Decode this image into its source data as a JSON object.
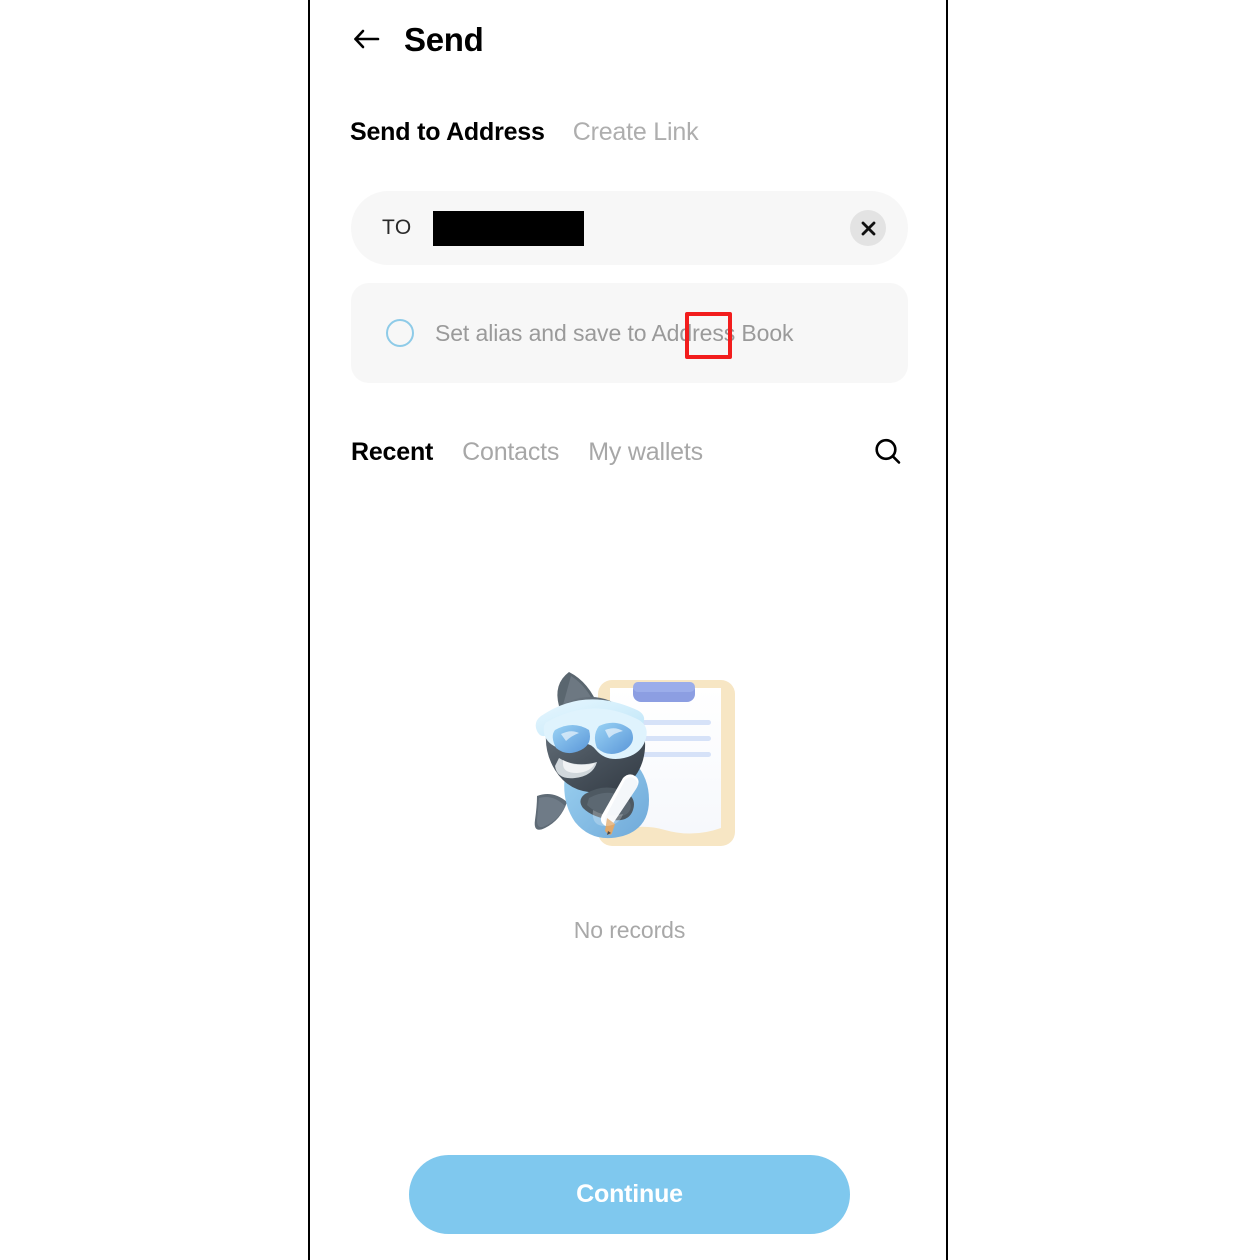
{
  "header": {
    "back_icon": "arrow-left-icon",
    "title": "Send"
  },
  "mode_tabs": [
    {
      "label": "Send to Address",
      "active": true
    },
    {
      "label": "Create Link",
      "active": false
    }
  ],
  "recipient_field": {
    "label": "TO",
    "value": "",
    "value_redacted": true,
    "placeholder": "",
    "clear_icon": "close-icon"
  },
  "alias_option": {
    "label": "Set alias and save to Address Book",
    "checked": false,
    "radio_icon": "radio-unchecked-icon",
    "highlighted": true,
    "highlight_color": "#F21D1D"
  },
  "list_tabs": [
    {
      "label": "Recent",
      "active": true
    },
    {
      "label": "Contacts",
      "active": false
    },
    {
      "label": "My wallets",
      "active": false
    }
  ],
  "search": {
    "icon": "search-icon"
  },
  "empty_state": {
    "illustration": "shark-mascot-with-clipboard-illustration",
    "message": "No records"
  },
  "footer": {
    "continue_label": "Continue",
    "continue_color": "#7FC8EE"
  },
  "colors": {
    "accent": "#7FC8EE",
    "field_bg": "#F7F7F7",
    "muted_text": "#A8A8A8",
    "primary_text": "#000000",
    "highlight": "#F21D1D"
  }
}
